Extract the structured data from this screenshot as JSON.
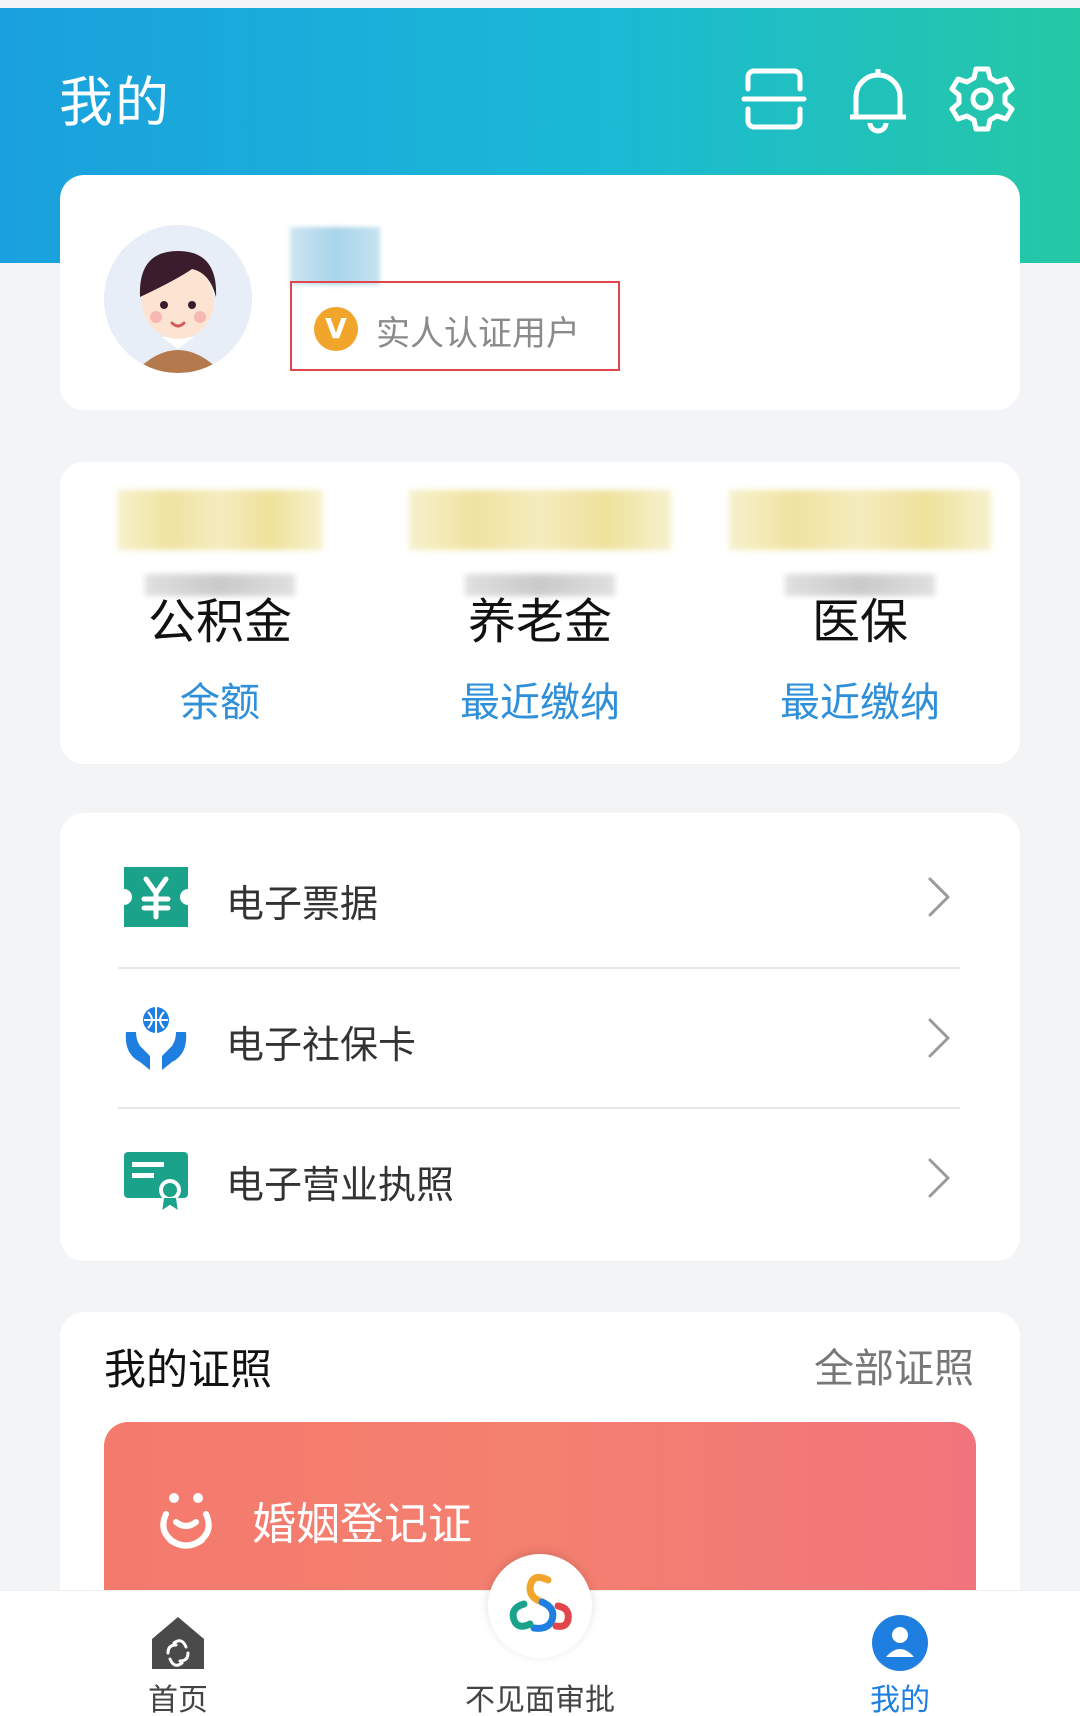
{
  "header": {
    "title": "我的",
    "icons": [
      "scan-icon",
      "bell-icon",
      "gear-icon"
    ]
  },
  "profile": {
    "verified_label": "实人认证用户",
    "badge_letter": "V"
  },
  "stats": [
    {
      "label": "公积金",
      "sub": "余额"
    },
    {
      "label": "养老金",
      "sub": "最近缴纳"
    },
    {
      "label": "医保",
      "sub": "最近缴纳"
    }
  ],
  "menu": [
    {
      "label": "电子票据",
      "icon": "receipt-icon"
    },
    {
      "label": "电子社保卡",
      "icon": "social-security-icon"
    },
    {
      "label": "电子营业执照",
      "icon": "business-license-icon"
    }
  ],
  "certificates": {
    "title": "我的证照",
    "all_link": "全部证照",
    "banner_label": "婚姻登记证"
  },
  "nav": {
    "home": "首页",
    "center": "不见面审批",
    "mine": "我的"
  },
  "colors": {
    "header_start": "#1aa0de",
    "header_end": "#25c8a5",
    "accent_blue": "#2f8fd8",
    "badge_orange": "#f2a52b",
    "banner_coral": "#f47a6e",
    "highlight_red": "#e0464a"
  }
}
